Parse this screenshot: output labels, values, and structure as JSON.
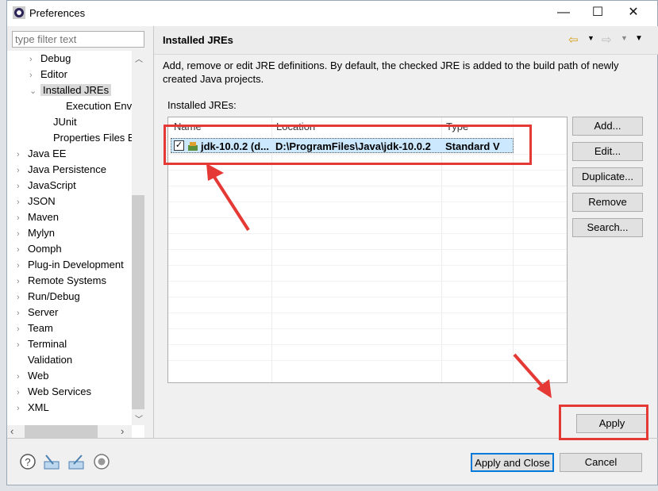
{
  "window": {
    "title": "Preferences",
    "minimize": "—",
    "maximize": "☐",
    "close": "✕"
  },
  "filter": {
    "placeholder": "type filter text"
  },
  "tree": {
    "items": [
      {
        "label": "Debug",
        "expand": "›",
        "indent": 1
      },
      {
        "label": "Editor",
        "expand": "›",
        "indent": 1
      },
      {
        "label": "Installed JREs",
        "expand": "⌄",
        "indent": 1,
        "selected": true
      },
      {
        "label": "Execution Enviro",
        "expand": "",
        "indent": 3
      },
      {
        "label": "JUnit",
        "expand": "",
        "indent": 2
      },
      {
        "label": "Properties Files Edi",
        "expand": "",
        "indent": 2
      },
      {
        "label": "Java EE",
        "expand": "›",
        "indent": 0
      },
      {
        "label": "Java Persistence",
        "expand": "›",
        "indent": 0
      },
      {
        "label": "JavaScript",
        "expand": "›",
        "indent": 0
      },
      {
        "label": "JSON",
        "expand": "›",
        "indent": 0
      },
      {
        "label": "Maven",
        "expand": "›",
        "indent": 0
      },
      {
        "label": "Mylyn",
        "expand": "›",
        "indent": 0
      },
      {
        "label": "Oomph",
        "expand": "›",
        "indent": 0
      },
      {
        "label": "Plug-in Development",
        "expand": "›",
        "indent": 0
      },
      {
        "label": "Remote Systems",
        "expand": "›",
        "indent": 0
      },
      {
        "label": "Run/Debug",
        "expand": "›",
        "indent": 0
      },
      {
        "label": "Server",
        "expand": "›",
        "indent": 0
      },
      {
        "label": "Team",
        "expand": "›",
        "indent": 0
      },
      {
        "label": "Terminal",
        "expand": "›",
        "indent": 0
      },
      {
        "label": "Validation",
        "expand": "",
        "indent": 0
      },
      {
        "label": "Web",
        "expand": "›",
        "indent": 0
      },
      {
        "label": "Web Services",
        "expand": "›",
        "indent": 0
      },
      {
        "label": "XML",
        "expand": "›",
        "indent": 0
      }
    ]
  },
  "page": {
    "title": "Installed JREs",
    "description_line1": "Add, remove or edit JRE definitions. By default, the checked JRE is added to the build path of newly",
    "description_line2": "created Java projects.",
    "table_label": "Installed JREs:",
    "columns": [
      "Name",
      "Location",
      "Type"
    ],
    "rows": [
      {
        "checked": true,
        "name": "jdk-10.0.2 (d...",
        "location": "D:\\ProgramFiles\\Java\\jdk-10.0.2",
        "type": "Standard V"
      }
    ],
    "buttons": {
      "add": "Add...",
      "edit": "Edit...",
      "duplicate": "Duplicate...",
      "remove": "Remove",
      "search": "Search..."
    },
    "apply": "Apply"
  },
  "footer": {
    "apply_close": "Apply and Close",
    "cancel": "Cancel"
  },
  "annotation_color": "#e53935"
}
